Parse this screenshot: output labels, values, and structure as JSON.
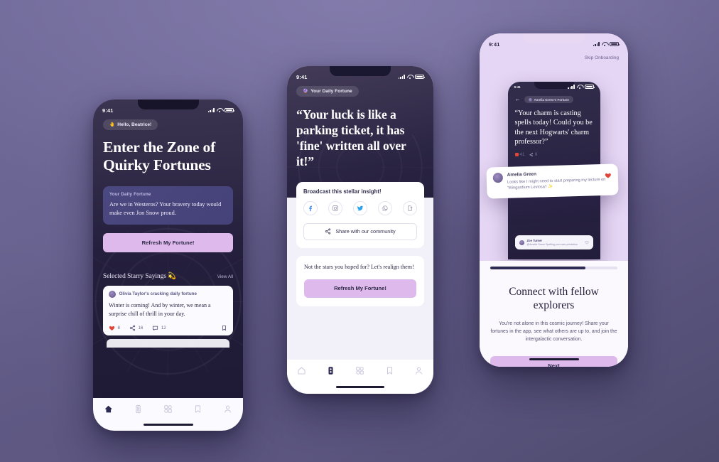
{
  "background": {
    "top_color": "#6d6796",
    "bottom_color": "#4e4a6d"
  },
  "accent": {
    "lilac": "#ddb9ec",
    "navy": "#2d2b54",
    "card_blue": "#4b4880"
  },
  "phone1": {
    "status": {
      "time": "9:41"
    },
    "greeting_pill": {
      "emoji": "🤚",
      "label": "Hello, Beatrice!"
    },
    "title": "Enter the Zone of Quirky Fortunes",
    "fortune_card": {
      "label": "Your Daily Fortune",
      "text": "Are we in Westeros? Your bravery today would make even Jon Snow proud."
    },
    "refresh_button": "Refresh My Fortune!",
    "section": {
      "title": "Selected Starry Sayings 💫",
      "view_all": "View All"
    },
    "post": {
      "author_line": "Olivia Taylor's cracking daily fortune",
      "text": "Winter is coming! And by winter, we mean a surprise chill of thrill in your day.",
      "likes": "8",
      "shares": "16",
      "comments": "12"
    },
    "tabs": [
      {
        "name": "home",
        "icon": "home-icon",
        "active": true
      },
      {
        "name": "fortune",
        "icon": "device-icon",
        "active": false
      },
      {
        "name": "explore",
        "icon": "grid-icon",
        "active": false
      },
      {
        "name": "saved",
        "icon": "bookmark-icon",
        "active": false
      },
      {
        "name": "profile",
        "icon": "person-icon",
        "active": false
      }
    ]
  },
  "phone2": {
    "status": {
      "time": "9:41"
    },
    "pill": {
      "emoji": "🔮",
      "label": "Your Daily Fortune"
    },
    "quote": "“Your luck is like a parking ticket, it has 'fine' written all over it!”",
    "share_card": {
      "title": "Broadcast this stellar insight!",
      "socials": [
        "facebook-icon",
        "instagram-icon",
        "twitter-icon",
        "whatsapp-icon",
        "export-icon"
      ],
      "community_button": "Share with our community"
    },
    "realign_card": {
      "text": "Not the stars you hoped for? Let's realign them!",
      "button": "Refresh My Fortune!"
    },
    "tabs": [
      {
        "name": "home",
        "icon": "home-icon",
        "active": false
      },
      {
        "name": "fortune",
        "icon": "device-icon",
        "active": true
      },
      {
        "name": "explore",
        "icon": "grid-icon",
        "active": false
      },
      {
        "name": "saved",
        "icon": "bookmark-icon",
        "active": false
      },
      {
        "name": "profile",
        "icon": "person-icon",
        "active": false
      }
    ]
  },
  "phone3": {
    "status": {
      "time": "9:41"
    },
    "skip": "Skip Onboarding",
    "mini": {
      "status_time": "9:41",
      "pill": "Amelia Green's Fortune",
      "quote": "“Your charm is casting spells today! Could you be the next Hogwarts' charm professor?”",
      "likes": "41",
      "shares": "9",
      "post": {
        "author": "Zoe Turner",
        "text": "@Amelia Green Spelling your own prediction"
      }
    },
    "notification": {
      "author": "Amelia Green",
      "text": "Looks like I might need to start preparing my lecture on 'Wingardium Leviosa'! ✨"
    },
    "progress_percent": 75,
    "heading": "Connect with fellow explorers",
    "body": "You're not alone in this cosmic journey! Share your fortunes in the app, see what others are up to, and join the intergalactic conversation.",
    "next_button": "Next"
  }
}
